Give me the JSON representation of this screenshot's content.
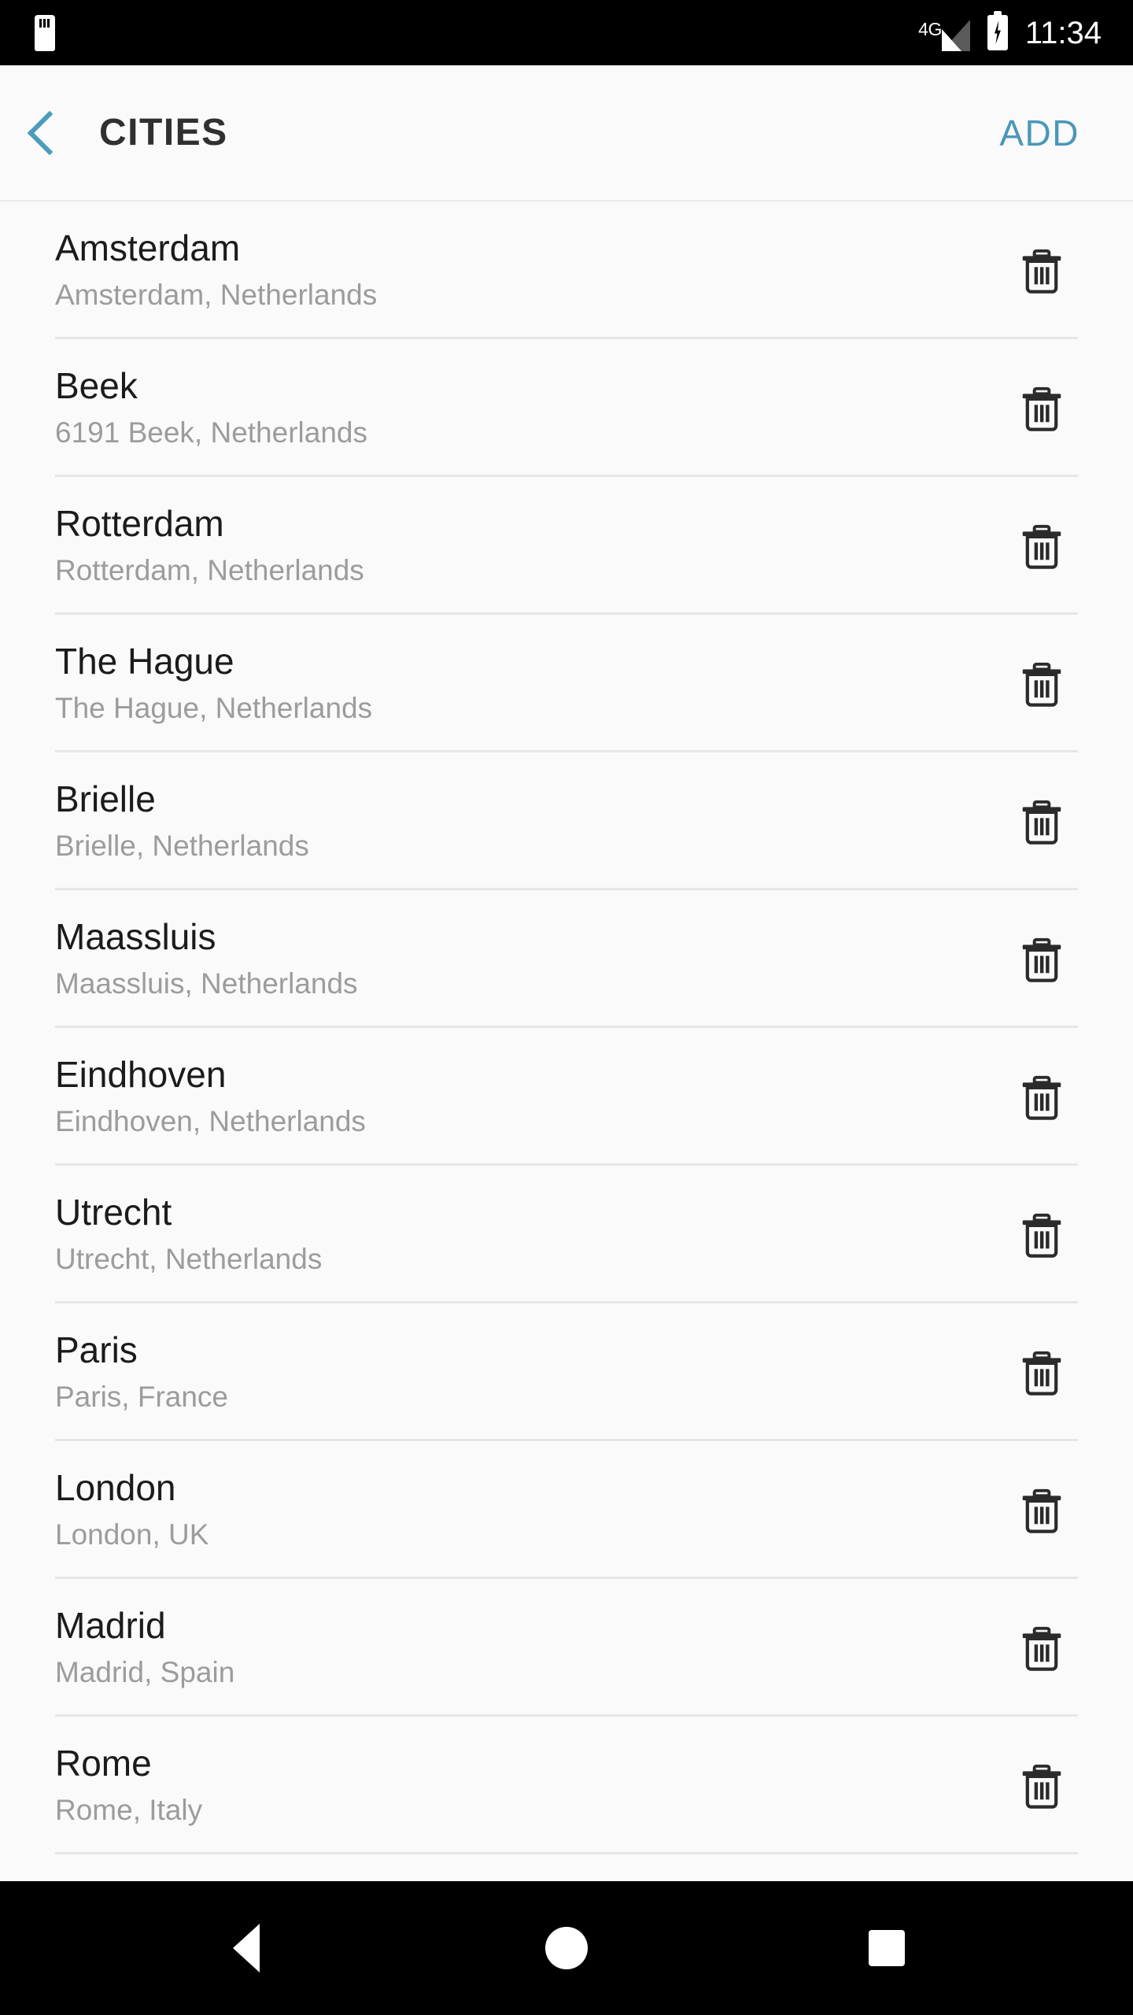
{
  "status_bar": {
    "sd_card_icon": "sd-card-icon",
    "network_label": "4G",
    "signal_icon": "signal-bars-icon",
    "battery_icon": "battery-charging-icon",
    "time": "11:34"
  },
  "app_bar": {
    "back_icon": "chevron-left-icon",
    "title": "CITIES",
    "add_label": "ADD"
  },
  "list": {
    "delete_icon": "trash-icon",
    "items": [
      {
        "name": "Amsterdam",
        "subtitle": "Amsterdam, Netherlands"
      },
      {
        "name": "Beek",
        "subtitle": "6191 Beek, Netherlands"
      },
      {
        "name": "Rotterdam",
        "subtitle": "Rotterdam, Netherlands"
      },
      {
        "name": "The Hague",
        "subtitle": "The Hague, Netherlands"
      },
      {
        "name": "Brielle",
        "subtitle": "Brielle, Netherlands"
      },
      {
        "name": "Maassluis",
        "subtitle": "Maassluis, Netherlands"
      },
      {
        "name": "Eindhoven",
        "subtitle": "Eindhoven, Netherlands"
      },
      {
        "name": "Utrecht",
        "subtitle": "Utrecht, Netherlands"
      },
      {
        "name": "Paris",
        "subtitle": "Paris, France"
      },
      {
        "name": "London",
        "subtitle": "London, UK"
      },
      {
        "name": "Madrid",
        "subtitle": "Madrid, Spain"
      },
      {
        "name": "Rome",
        "subtitle": "Rome, Italy"
      }
    ]
  },
  "nav_bar": {
    "back_icon": "triangle-back-icon",
    "home_icon": "circle-home-icon",
    "recents_icon": "square-recents-icon"
  },
  "colors": {
    "accent": "#4A97B8",
    "page_background": "#FAFAFA",
    "title_text": "#1B1B1B",
    "subtitle_text": "#9C9C9C",
    "divider": "#E6E6E6",
    "system_bar": "#000000"
  }
}
